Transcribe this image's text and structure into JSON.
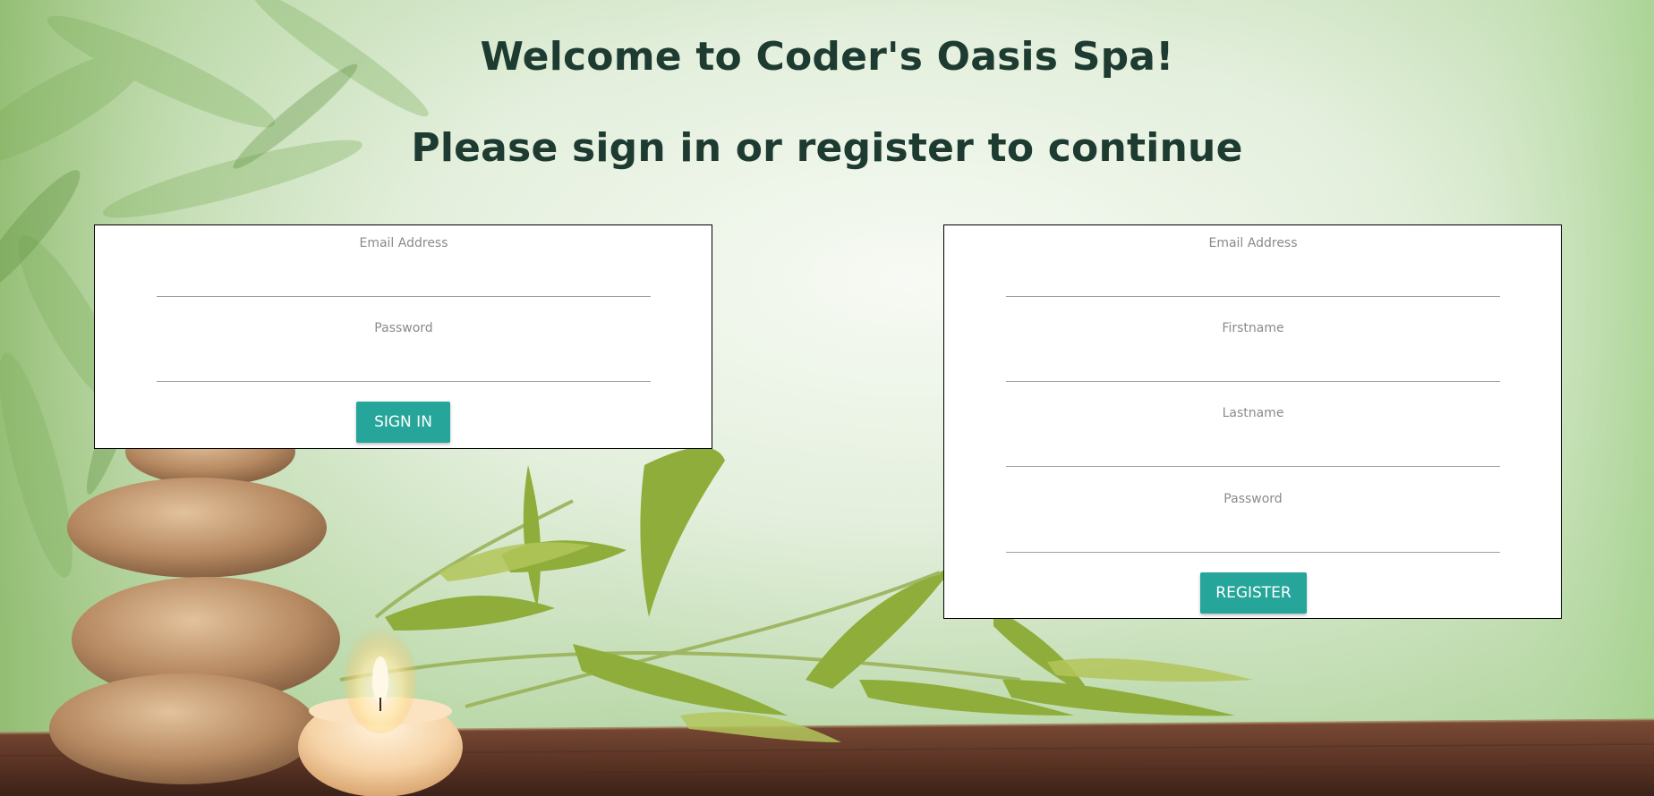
{
  "page": {
    "heading_welcome": "Welcome to Coder's Oasis Spa!",
    "heading_prompt": "Please sign in or register to continue"
  },
  "signin": {
    "email_label": "Email Address",
    "email_value": "",
    "password_label": "Password",
    "password_value": "",
    "submit_label": "SIGN IN"
  },
  "register": {
    "email_label": "Email Address",
    "email_value": "",
    "firstname_label": "Firstname",
    "firstname_value": "",
    "lastname_label": "Lastname",
    "lastname_value": "",
    "password_label": "Password",
    "password_value": "",
    "submit_label": "REGISTER"
  },
  "colors": {
    "heading": "#1d3b30",
    "button": "#26a69a",
    "card_border": "#000000"
  }
}
